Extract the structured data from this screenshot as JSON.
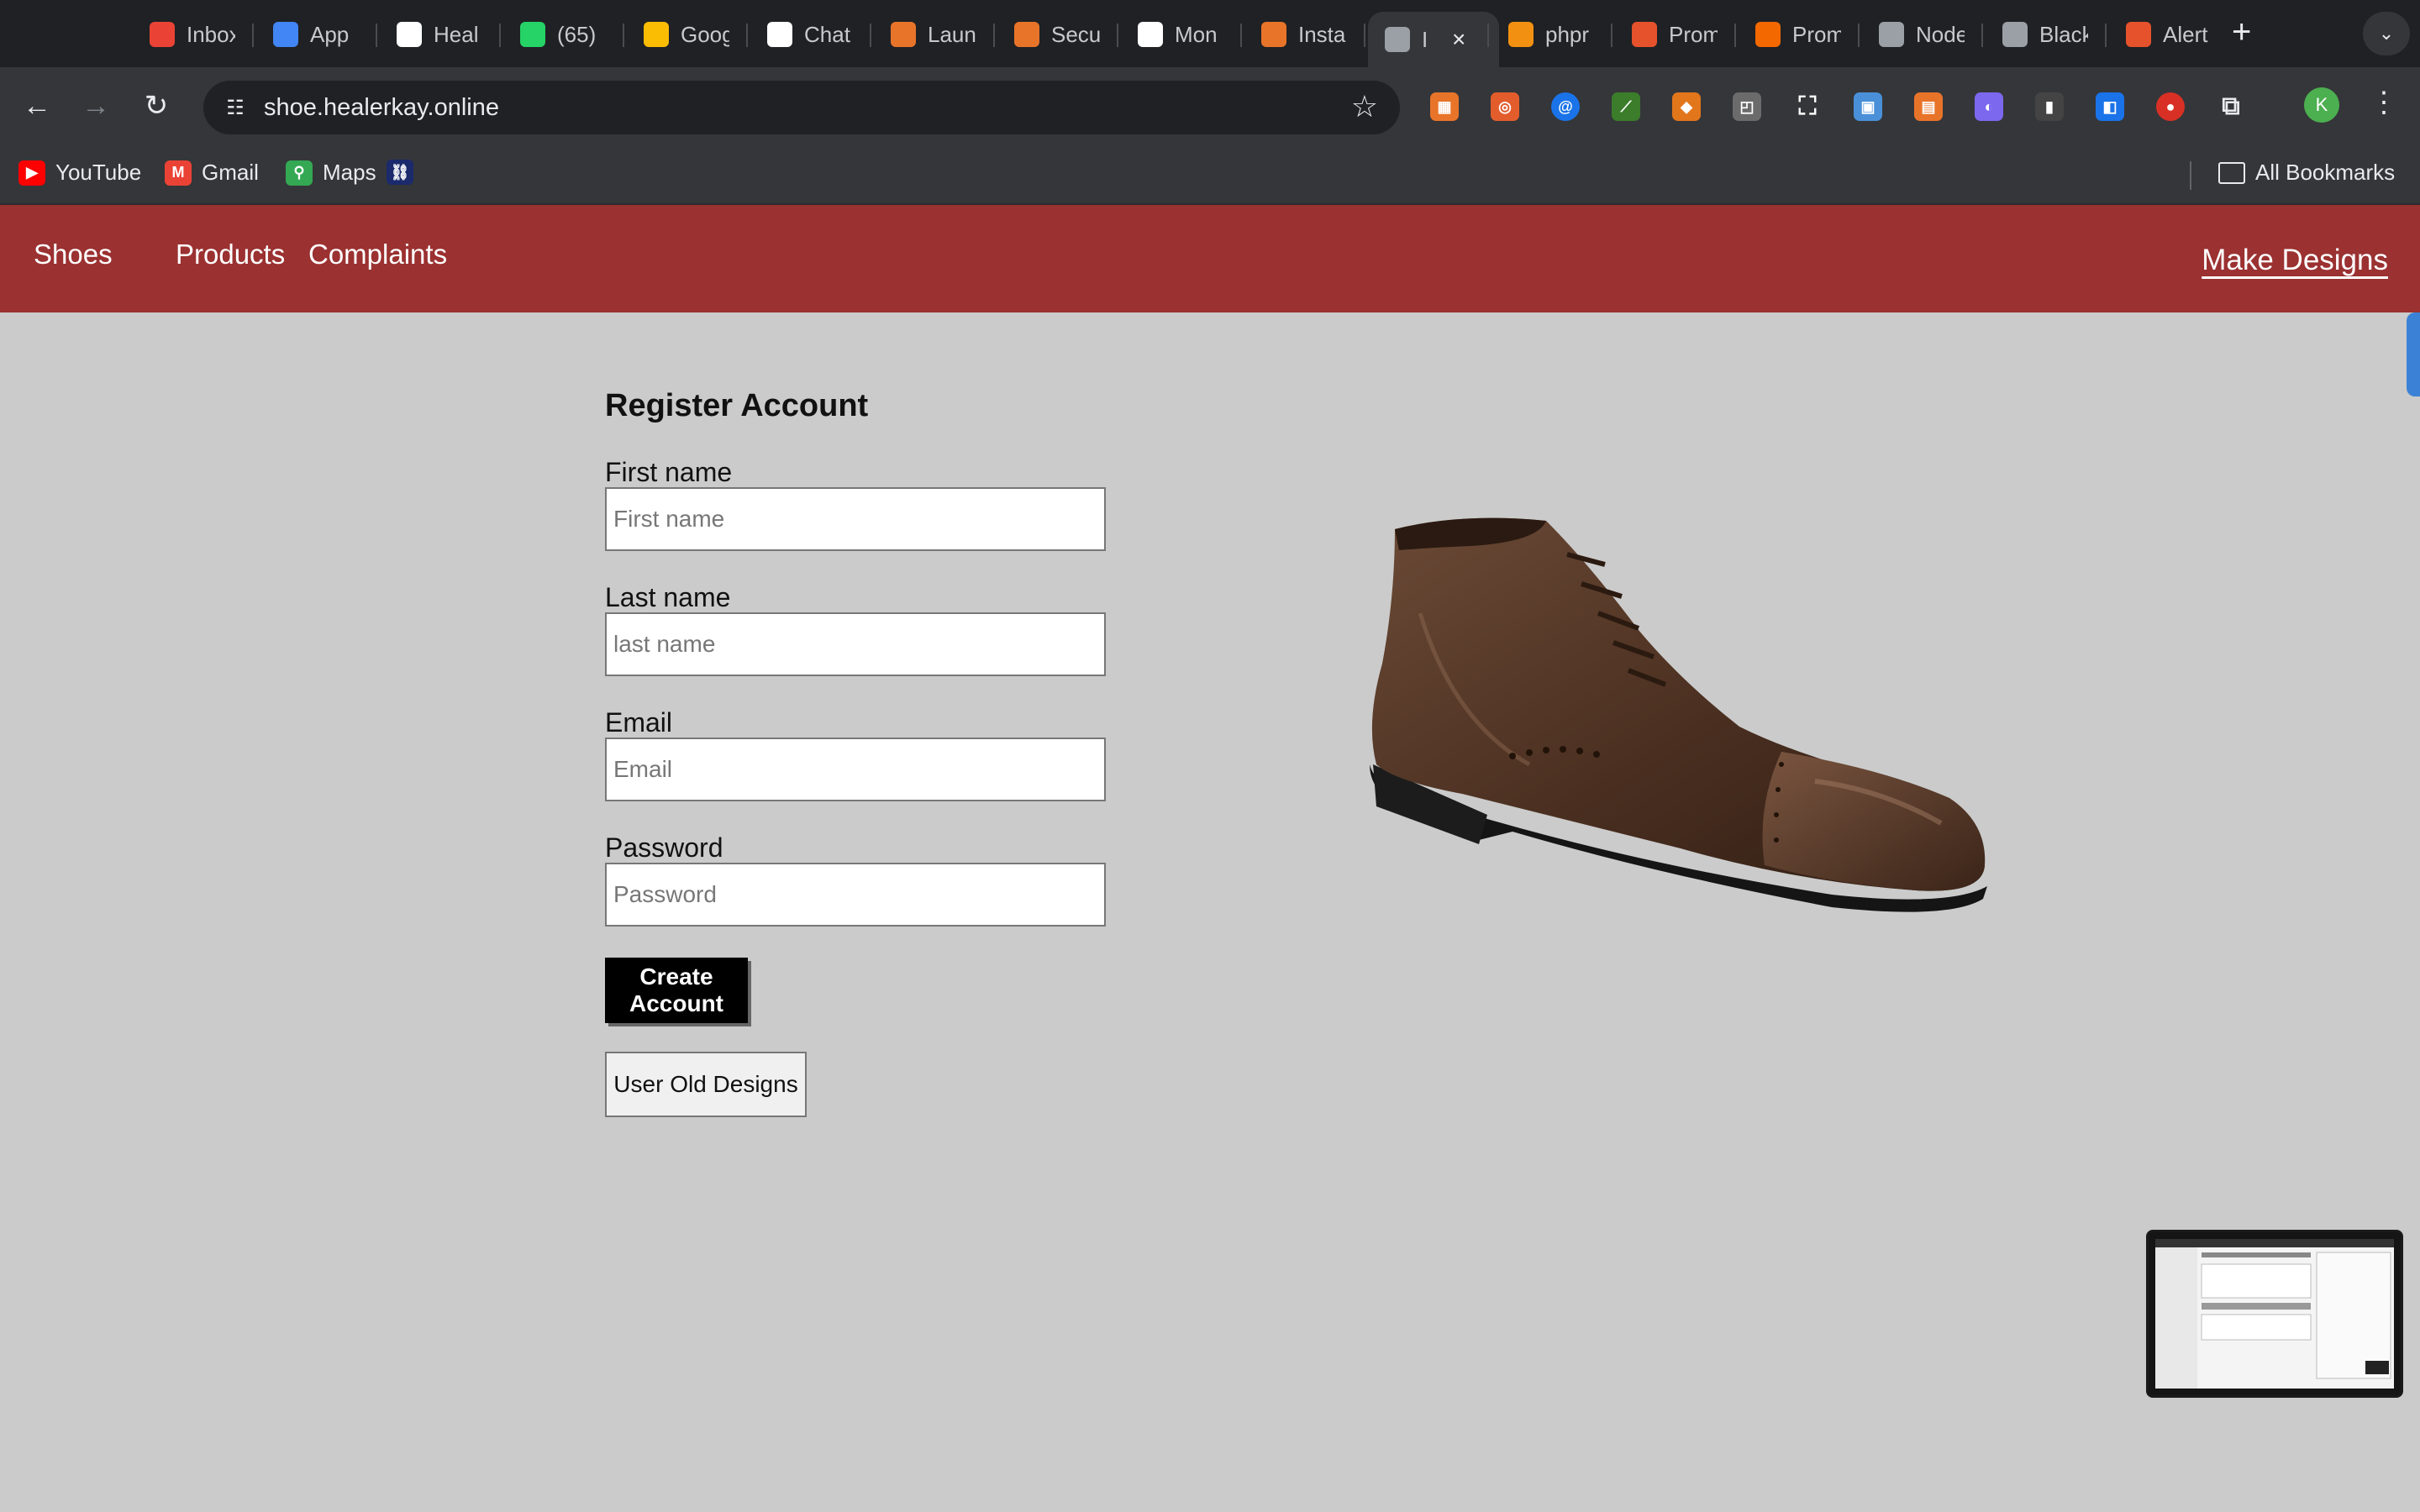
{
  "browser": {
    "tabs": [
      {
        "title": "Inbox",
        "icon": "gmail-icon",
        "color": "#ea4335"
      },
      {
        "title": "App",
        "icon": "google-icon",
        "color": "#4285f4"
      },
      {
        "title": "Heal",
        "icon": "github-icon",
        "color": "#ffffff"
      },
      {
        "title": "(65)",
        "icon": "whatsapp-icon",
        "color": "#25d366"
      },
      {
        "title": "Goog",
        "icon": "keep-icon",
        "color": "#fbbc04"
      },
      {
        "title": "Chat",
        "icon": "openai-icon",
        "color": "#ffffff"
      },
      {
        "title": "Laun",
        "icon": "aws-icon",
        "color": "#e8742a"
      },
      {
        "title": "Secu",
        "icon": "aws-icon",
        "color": "#e8742a"
      },
      {
        "title": "Mon",
        "icon": "github-icon",
        "color": "#ffffff"
      },
      {
        "title": "Insta",
        "icon": "aws-icon",
        "color": "#e8742a"
      },
      {
        "title": "I",
        "icon": "globe-icon",
        "color": "#9aa0a6",
        "active": true
      },
      {
        "title": "phpr",
        "icon": "phpmyadmin-icon",
        "color": "#f29111"
      },
      {
        "title": "Prom",
        "icon": "prometheus-icon",
        "color": "#e6522c"
      },
      {
        "title": "Prom",
        "icon": "grafana-icon",
        "color": "#f46800"
      },
      {
        "title": "Node",
        "icon": "globe-icon",
        "color": "#9aa0a6"
      },
      {
        "title": "Black",
        "icon": "globe-icon",
        "color": "#9aa0a6"
      },
      {
        "title": "Alert",
        "icon": "alertmanager-icon",
        "color": "#e6522c"
      }
    ],
    "url": "shoe.healerkay.online",
    "profile_initial": "K",
    "bookmarks": [
      {
        "label": "YouTube",
        "icon": "youtube-icon",
        "color": "#ff0000"
      },
      {
        "label": "Gmail",
        "icon": "gmail-icon",
        "color": "#ea4335"
      },
      {
        "label": "Maps",
        "icon": "maps-icon",
        "color": "#34a853"
      }
    ],
    "all_bookmarks": "All Bookmarks"
  },
  "site": {
    "nav": {
      "brand": "Shoes",
      "products": "Products",
      "complaints": "Complaints",
      "make_designs": "Make Designs"
    },
    "form": {
      "title": "Register Account",
      "first_name_label": "First name",
      "first_name_placeholder": "First name",
      "last_name_label": "Last name",
      "last_name_placeholder": "last name",
      "email_label": "Email",
      "email_placeholder": "Email",
      "password_label": "Password",
      "password_placeholder": "Password",
      "create_button": "Create Account",
      "old_designs_button": "User Old Designs"
    }
  }
}
